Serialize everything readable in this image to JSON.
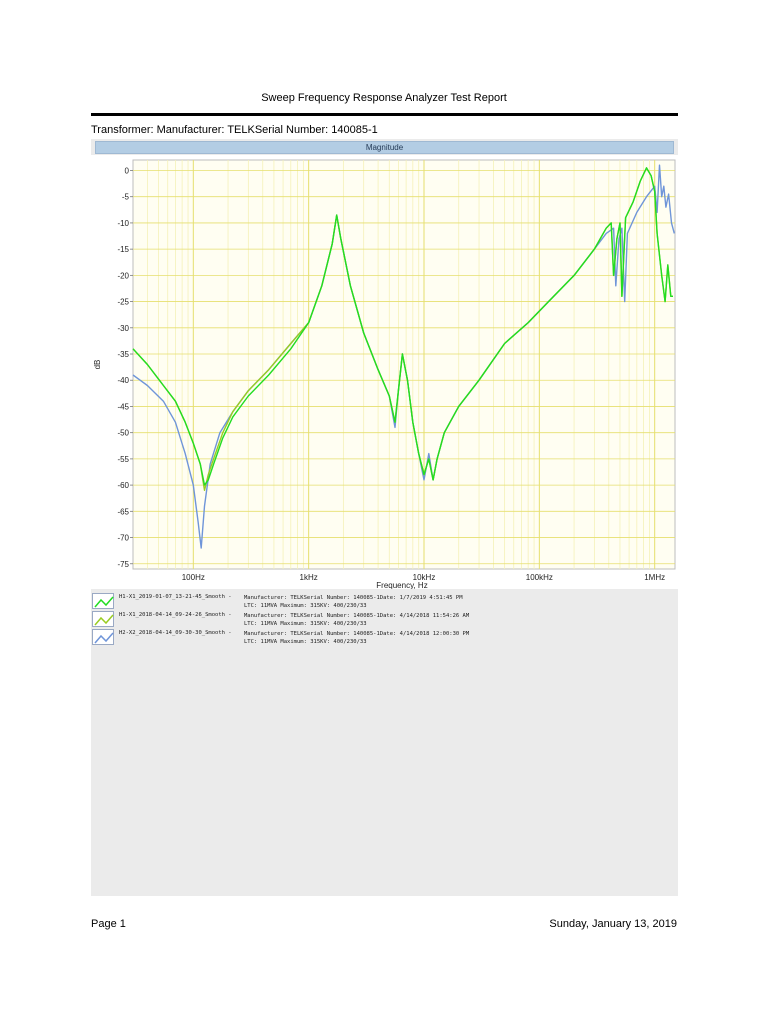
{
  "report": {
    "title": "Sweep Frequency Response Analyzer Test Report",
    "transformer_line": "Transformer: Manufacturer: TELKSerial Number: 140085-1"
  },
  "footer": {
    "page": "Page 1",
    "date": "Sunday, January 13, 2019"
  },
  "colors": {
    "green": "#22dd22",
    "yellowgreen": "#99cc22",
    "blue": "#6f95d9",
    "header": "#b3cde4",
    "major_grid": "#e6df6e",
    "minor_grid": "#f5f1b8"
  },
  "legend": [
    {
      "name": "H1-X1_2019-01-07_13-21-45_Smooth -",
      "desc1": "Manufacturer: TELKSerial Number: 140085-1Date: 1/7/2019 4:51:45 PM",
      "desc2": "LTC: 11MVA Maximum: 315KV: 400/230/33",
      "color": "#22dd22"
    },
    {
      "name": "H1-X1_2018-04-14_09-24-26_Smooth -",
      "desc1": "Manufacturer: TELKSerial Number: 140085-1Date: 4/14/2018 11:54:26 AM",
      "desc2": "LTC: 11MVA Maximum: 315KV: 400/230/33",
      "color": "#99cc22"
    },
    {
      "name": "H2-X2_2018-04-14_09-30-30_Smooth -",
      "desc1": "Manufacturer: TELKSerial Number: 140085-1Date: 4/14/2018 12:00:30 PM",
      "desc2": "LTC: 11MVA Maximum: 315KV: 400/230/33",
      "color": "#6f95d9"
    }
  ],
  "chart_data": {
    "type": "line",
    "title": "Magnitude",
    "xlabel": "Frequency, Hz",
    "ylabel": "dB",
    "x_scale": "log",
    "xlim": [
      30,
      1500000
    ],
    "ylim": [
      -76,
      2
    ],
    "x_ticks": [
      {
        "value": 100,
        "label": "100Hz"
      },
      {
        "value": 1000,
        "label": "1kHz"
      },
      {
        "value": 10000,
        "label": "10kHz"
      },
      {
        "value": 100000,
        "label": "100kHz"
      },
      {
        "value": 1000000,
        "label": "1MHz"
      }
    ],
    "y_ticks": [
      0,
      -5,
      -10,
      -15,
      -20,
      -25,
      -30,
      -35,
      -40,
      -45,
      -50,
      -55,
      -60,
      -65,
      -70,
      -75
    ],
    "grid": true,
    "series": [
      {
        "name": "H1-X1_2019-01-07_13-21-45_Smooth",
        "color": "#22dd22",
        "points": [
          [
            30,
            -34
          ],
          [
            40,
            -37
          ],
          [
            55,
            -41
          ],
          [
            70,
            -44
          ],
          [
            85,
            -48
          ],
          [
            100,
            -52
          ],
          [
            115,
            -56
          ],
          [
            125,
            -60
          ],
          [
            135,
            -59
          ],
          [
            150,
            -56
          ],
          [
            180,
            -51
          ],
          [
            220,
            -47
          ],
          [
            300,
            -43
          ],
          [
            450,
            -39
          ],
          [
            700,
            -34
          ],
          [
            1000,
            -29
          ],
          [
            1300,
            -22
          ],
          [
            1600,
            -14
          ],
          [
            1750,
            -8.5
          ],
          [
            1900,
            -13
          ],
          [
            2300,
            -22
          ],
          [
            3000,
            -31
          ],
          [
            4000,
            -38
          ],
          [
            5000,
            -43
          ],
          [
            5600,
            -48
          ],
          [
            6000,
            -42
          ],
          [
            6500,
            -35
          ],
          [
            7200,
            -40
          ],
          [
            8000,
            -48
          ],
          [
            9000,
            -54
          ],
          [
            10000,
            -58
          ],
          [
            11000,
            -55
          ],
          [
            12000,
            -59
          ],
          [
            13000,
            -55
          ],
          [
            15000,
            -50
          ],
          [
            20000,
            -45
          ],
          [
            30000,
            -40
          ],
          [
            50000,
            -33
          ],
          [
            80000,
            -29
          ],
          [
            120000,
            -25
          ],
          [
            200000,
            -20
          ],
          [
            300000,
            -15
          ],
          [
            380000,
            -11
          ],
          [
            420000,
            -10
          ],
          [
            440000,
            -20
          ],
          [
            470000,
            -13
          ],
          [
            500000,
            -10
          ],
          [
            520000,
            -24
          ],
          [
            560000,
            -9
          ],
          [
            650000,
            -6
          ],
          [
            750000,
            -2
          ],
          [
            850000,
            0.5
          ],
          [
            930000,
            -1
          ],
          [
            1000000,
            -4
          ],
          [
            1050000,
            -12
          ],
          [
            1150000,
            -20
          ],
          [
            1230000,
            -25
          ],
          [
            1300000,
            -18
          ],
          [
            1380000,
            -24
          ],
          [
            1440000,
            -24
          ]
        ]
      },
      {
        "name": "H1-X1_2018-04-14_09-24-26_Smooth",
        "color": "#99cc22",
        "points": [
          [
            30,
            -34
          ],
          [
            40,
            -37
          ],
          [
            55,
            -41
          ],
          [
            70,
            -44
          ],
          [
            85,
            -48
          ],
          [
            100,
            -52
          ],
          [
            115,
            -56
          ],
          [
            125,
            -61
          ],
          [
            135,
            -58
          ],
          [
            150,
            -55
          ],
          [
            180,
            -50
          ],
          [
            220,
            -46
          ],
          [
            300,
            -42
          ],
          [
            450,
            -38
          ],
          [
            700,
            -33
          ],
          [
            1000,
            -29
          ],
          [
            1300,
            -22
          ],
          [
            1600,
            -14
          ],
          [
            1750,
            -8.5
          ],
          [
            1900,
            -13
          ],
          [
            2300,
            -22
          ],
          [
            3000,
            -31
          ],
          [
            4000,
            -38
          ],
          [
            5000,
            -43
          ],
          [
            5600,
            -48
          ],
          [
            6000,
            -42
          ],
          [
            6500,
            -35
          ],
          [
            7200,
            -40
          ],
          [
            8000,
            -48
          ],
          [
            9000,
            -54
          ],
          [
            10000,
            -58
          ],
          [
            11000,
            -55
          ],
          [
            12000,
            -59
          ],
          [
            13000,
            -55
          ],
          [
            15000,
            -50
          ],
          [
            20000,
            -45
          ],
          [
            30000,
            -40
          ],
          [
            50000,
            -33
          ],
          [
            80000,
            -29
          ],
          [
            120000,
            -25
          ],
          [
            200000,
            -20
          ],
          [
            300000,
            -15
          ],
          [
            380000,
            -11
          ],
          [
            420000,
            -10
          ],
          [
            440000,
            -20
          ],
          [
            470000,
            -13
          ],
          [
            500000,
            -10
          ],
          [
            520000,
            -24
          ],
          [
            560000,
            -9
          ],
          [
            650000,
            -6
          ],
          [
            750000,
            -2
          ],
          [
            850000,
            0.5
          ],
          [
            930000,
            -1
          ],
          [
            1000000,
            -4
          ],
          [
            1050000,
            -12
          ],
          [
            1150000,
            -20
          ],
          [
            1230000,
            -25
          ],
          [
            1300000,
            -18
          ],
          [
            1380000,
            -24
          ],
          [
            1440000,
            -24
          ]
        ]
      },
      {
        "name": "H2-X2_2018-04-14_09-30-30_Smooth",
        "color": "#6f95d9",
        "points": [
          [
            30,
            -39
          ],
          [
            40,
            -41
          ],
          [
            55,
            -44
          ],
          [
            70,
            -48
          ],
          [
            85,
            -54
          ],
          [
            100,
            -60
          ],
          [
            110,
            -67
          ],
          [
            117,
            -72
          ],
          [
            125,
            -64
          ],
          [
            140,
            -56
          ],
          [
            170,
            -50
          ],
          [
            220,
            -46
          ],
          [
            300,
            -42
          ],
          [
            450,
            -38
          ],
          [
            700,
            -33
          ],
          [
            1000,
            -29
          ],
          [
            1300,
            -22
          ],
          [
            1600,
            -14
          ],
          [
            1750,
            -8.5
          ],
          [
            1900,
            -13
          ],
          [
            2300,
            -22
          ],
          [
            3000,
            -31
          ],
          [
            4000,
            -38
          ],
          [
            5000,
            -43
          ],
          [
            5600,
            -49
          ],
          [
            6000,
            -42
          ],
          [
            6500,
            -35
          ],
          [
            7200,
            -40
          ],
          [
            8000,
            -48
          ],
          [
            9000,
            -54
          ],
          [
            10000,
            -59
          ],
          [
            11000,
            -54
          ],
          [
            12000,
            -59
          ],
          [
            13000,
            -55
          ],
          [
            15000,
            -50
          ],
          [
            20000,
            -45
          ],
          [
            30000,
            -40
          ],
          [
            50000,
            -33
          ],
          [
            80000,
            -29
          ],
          [
            120000,
            -25
          ],
          [
            200000,
            -20
          ],
          [
            300000,
            -15
          ],
          [
            380000,
            -12
          ],
          [
            440000,
            -11
          ],
          [
            460000,
            -22
          ],
          [
            490000,
            -13
          ],
          [
            520000,
            -11
          ],
          [
            550000,
            -25
          ],
          [
            580000,
            -12
          ],
          [
            700000,
            -8
          ],
          [
            850000,
            -5
          ],
          [
            1000000,
            -3
          ],
          [
            1050000,
            -8
          ],
          [
            1100000,
            1
          ],
          [
            1150000,
            -5
          ],
          [
            1200000,
            -3
          ],
          [
            1250000,
            -7
          ],
          [
            1320000,
            -4.5
          ],
          [
            1400000,
            -10
          ],
          [
            1480000,
            -12
          ]
        ]
      }
    ]
  }
}
